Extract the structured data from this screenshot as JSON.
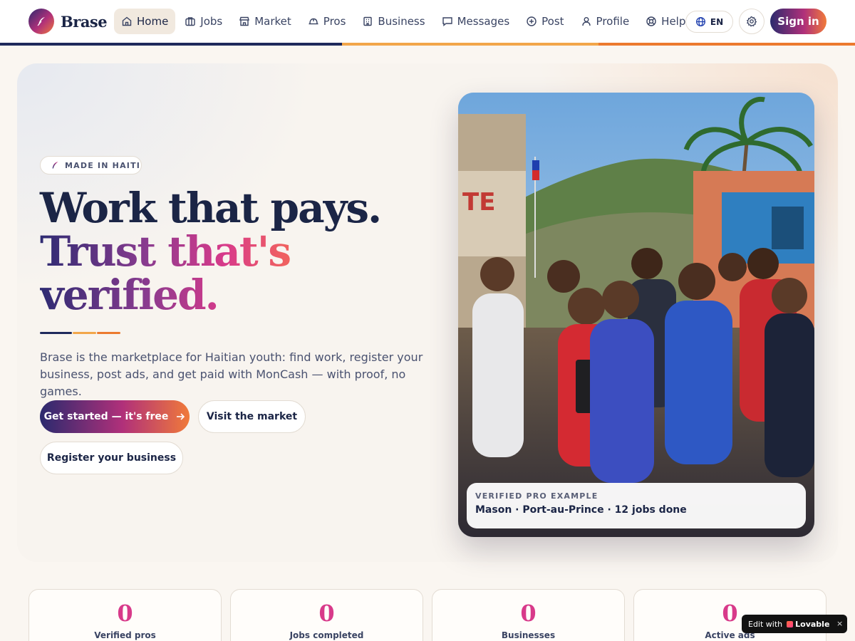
{
  "nav": {
    "brand": "Brase",
    "items": [
      {
        "label": "Home",
        "icon": "home-icon",
        "active": true
      },
      {
        "label": "Jobs",
        "icon": "briefcase-icon",
        "active": false
      },
      {
        "label": "Market",
        "icon": "store-icon",
        "active": false
      },
      {
        "label": "Pros",
        "icon": "hardhat-icon",
        "active": false
      },
      {
        "label": "Business",
        "icon": "building-icon",
        "active": false
      },
      {
        "label": "Messages",
        "icon": "message-icon",
        "active": false
      },
      {
        "label": "Post",
        "icon": "plus-circle-icon",
        "active": false
      },
      {
        "label": "Profile",
        "icon": "user-icon",
        "active": false
      },
      {
        "label": "Help",
        "icon": "lifebuoy-icon",
        "active": false
      }
    ],
    "language": "EN",
    "signin_label": "Sign in"
  },
  "hero": {
    "badge": "MADE IN HAITI",
    "headline_line1": "Work that pays.",
    "headline_line2": "Trust that's",
    "headline_line3": "verified.",
    "lead": "Brase is the marketplace for Haitian youth: find work, register your business, post ads, and get paid with MonCash — with proof, no games.",
    "cta_primary": "Get started — it's free",
    "cta_market": "Visit the market",
    "cta_register": "Register your business",
    "photo_caption_eyebrow": "VERIFIED PRO EXAMPLE",
    "photo_caption_text": "Mason · Port-au-Prince · 12 jobs done"
  },
  "stats": [
    {
      "value": "0",
      "label": "Verified pros"
    },
    {
      "value": "0",
      "label": "Jobs completed"
    },
    {
      "value": "0",
      "label": "Businesses"
    },
    {
      "value": "0",
      "label": "Active ads"
    }
  ],
  "edit_badge": {
    "prefix": "Edit with",
    "brand": "Lovable",
    "close": "×"
  },
  "colors": {
    "navy": "#1b2546",
    "magenta": "#d83a8a",
    "orange": "#f07a3a",
    "cream": "#faf6f1"
  }
}
